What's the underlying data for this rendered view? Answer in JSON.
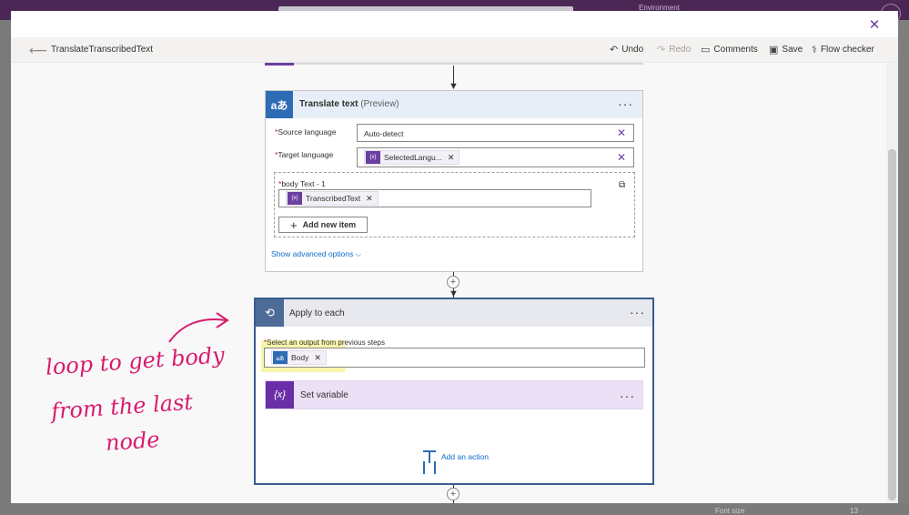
{
  "background": {
    "environment_label": "Environment",
    "font_size_label": "Font size",
    "font_size_value": "13"
  },
  "header": {
    "flow_title": "TranslateTranscribedText",
    "commands": {
      "undo": "Undo",
      "redo": "Redo",
      "comments": "Comments",
      "save": "Save",
      "flow_checker": "Flow checker"
    }
  },
  "translate_card": {
    "title": "Translate text",
    "title_suffix": "(Preview)",
    "source_language": {
      "label": "Source language",
      "value": "Auto-detect"
    },
    "target_language": {
      "label": "Target language",
      "token": "SelectedLangu..."
    },
    "body_text": {
      "label": "body Text - 1",
      "token": "TranscribedText"
    },
    "add_item_label": "Add new item",
    "advanced_options_label": "Show advanced options"
  },
  "apply_card": {
    "title": "Apply to each",
    "select_label": "Select an output from previous steps",
    "token": "Body",
    "set_variable": {
      "title": "Set variable",
      "icon_text": "{x}"
    },
    "add_action_label": "Add an action"
  },
  "annotation": {
    "lines": [
      "loop to get body",
      "from the last",
      "node"
    ],
    "color": "#d81b6e"
  },
  "colors": {
    "accent_purple": "#6b3fa0",
    "translate_icon": "#2e6bb5",
    "apply_icon": "#4c6b96",
    "set_variable_icon": "#6b2ea8",
    "link_blue": "#0b6bcb",
    "highlight_yellow": "#f7f59e"
  }
}
